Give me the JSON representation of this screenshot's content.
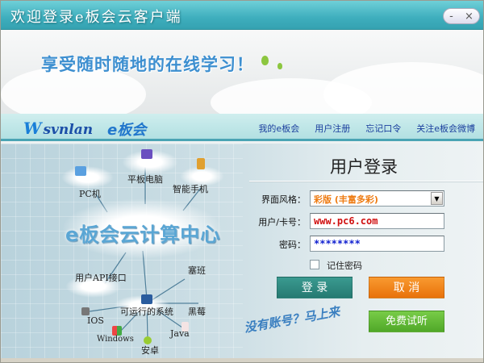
{
  "window": {
    "title": "欢迎登录e板会云客户端",
    "minimize": "-",
    "close": "×"
  },
  "banner": {
    "slogan": "享受随时随地的在线学习！"
  },
  "nav": {
    "logo_text": "svnlan",
    "logo_sub": "e板会",
    "links": [
      "我的e板会",
      "用户注册",
      "忘记口令",
      "关注e板会微博"
    ]
  },
  "diagram": {
    "center": "e板会云计算中心",
    "nodes": {
      "tablet": "平板电脑",
      "pc": "PC机",
      "phone": "智能手机",
      "api": "用户API接口",
      "symbian": "塞班",
      "systems": "可运行的系统",
      "blackberry": "黑莓",
      "ios": "IOS",
      "windows": "Windows",
      "java": "Java",
      "android": "安卓"
    }
  },
  "login": {
    "title": "用户登录",
    "style_label": "界面风格：",
    "style_value": "彩版 (丰富多彩)",
    "user_label": "用户/卡号：",
    "user_value": "www.pc6.com",
    "pass_label": "密码：",
    "pass_value": "********",
    "remember_label": "记住密码",
    "login_button": "登  录",
    "cancel_button": "取  消",
    "trial_button": "免费试听",
    "signup_prompt": "没有账号？马上来"
  },
  "colors": {
    "title_bar": "#3eaebd",
    "login_btn": "#2e8a80",
    "cancel_btn": "#ee7a10",
    "trial_btn": "#5cb82e"
  }
}
